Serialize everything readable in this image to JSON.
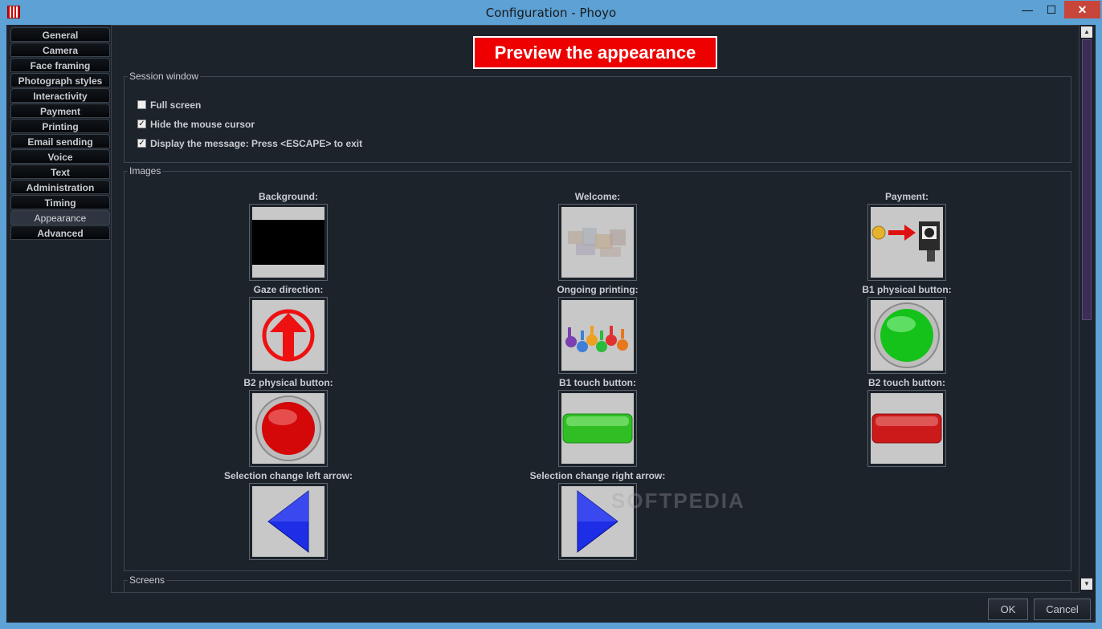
{
  "window": {
    "title": "Configuration - Phoyo",
    "minimize": "—",
    "maximize": "☐",
    "close": "✕"
  },
  "sidebar": {
    "tabs": [
      {
        "label": "General"
      },
      {
        "label": "Camera"
      },
      {
        "label": "Face framing"
      },
      {
        "label": "Photograph styles"
      },
      {
        "label": "Interactivity"
      },
      {
        "label": "Payment"
      },
      {
        "label": "Printing"
      },
      {
        "label": "Email sending"
      },
      {
        "label": "Voice"
      },
      {
        "label": "Text"
      },
      {
        "label": "Administration"
      },
      {
        "label": "Timing"
      },
      {
        "label": "Appearance",
        "active": true
      },
      {
        "label": "Advanced"
      }
    ]
  },
  "preview_button": "Preview the appearance",
  "session": {
    "title": "Session window",
    "options": [
      {
        "label": "Full screen",
        "checked": false
      },
      {
        "label": "Hide the mouse cursor",
        "checked": true
      },
      {
        "label": "Display the message: Press <ESCAPE> to exit",
        "checked": true
      }
    ],
    "check_mark": "✓"
  },
  "images": {
    "title": "Images",
    "items": [
      {
        "label": "Background:",
        "icon": "black-rectangle-thumbnail"
      },
      {
        "label": "Welcome:",
        "icon": "faded-collage-thumbnail"
      },
      {
        "label": "Payment:",
        "icon": "coin-arrow-machine-thumbnail"
      },
      {
        "label": "Gaze direction:",
        "icon": "red-up-arrow-thumbnail"
      },
      {
        "label": "Ongoing printing:",
        "icon": "running-gears-thumbnail"
      },
      {
        "label": "B1 physical button:",
        "icon": "green-round-button-thumbnail"
      },
      {
        "label": "B2 physical button:",
        "icon": "red-round-button-thumbnail"
      },
      {
        "label": "B1 touch button:",
        "icon": "green-bar-button-thumbnail"
      },
      {
        "label": "B2 touch button:",
        "icon": "red-bar-button-thumbnail"
      },
      {
        "label": "Selection change left arrow:",
        "icon": "blue-left-arrow-thumbnail"
      },
      {
        "label": "Selection change right arrow:",
        "icon": "blue-right-arrow-thumbnail"
      }
    ]
  },
  "screens": {
    "title": "Screens"
  },
  "footer": {
    "ok": "OK",
    "cancel": "Cancel"
  },
  "watermark": "SOFTPEDIA",
  "colors": {
    "background": "#1d232b",
    "accent_red": "#ee0000",
    "title_bar": "#5da1d5"
  }
}
